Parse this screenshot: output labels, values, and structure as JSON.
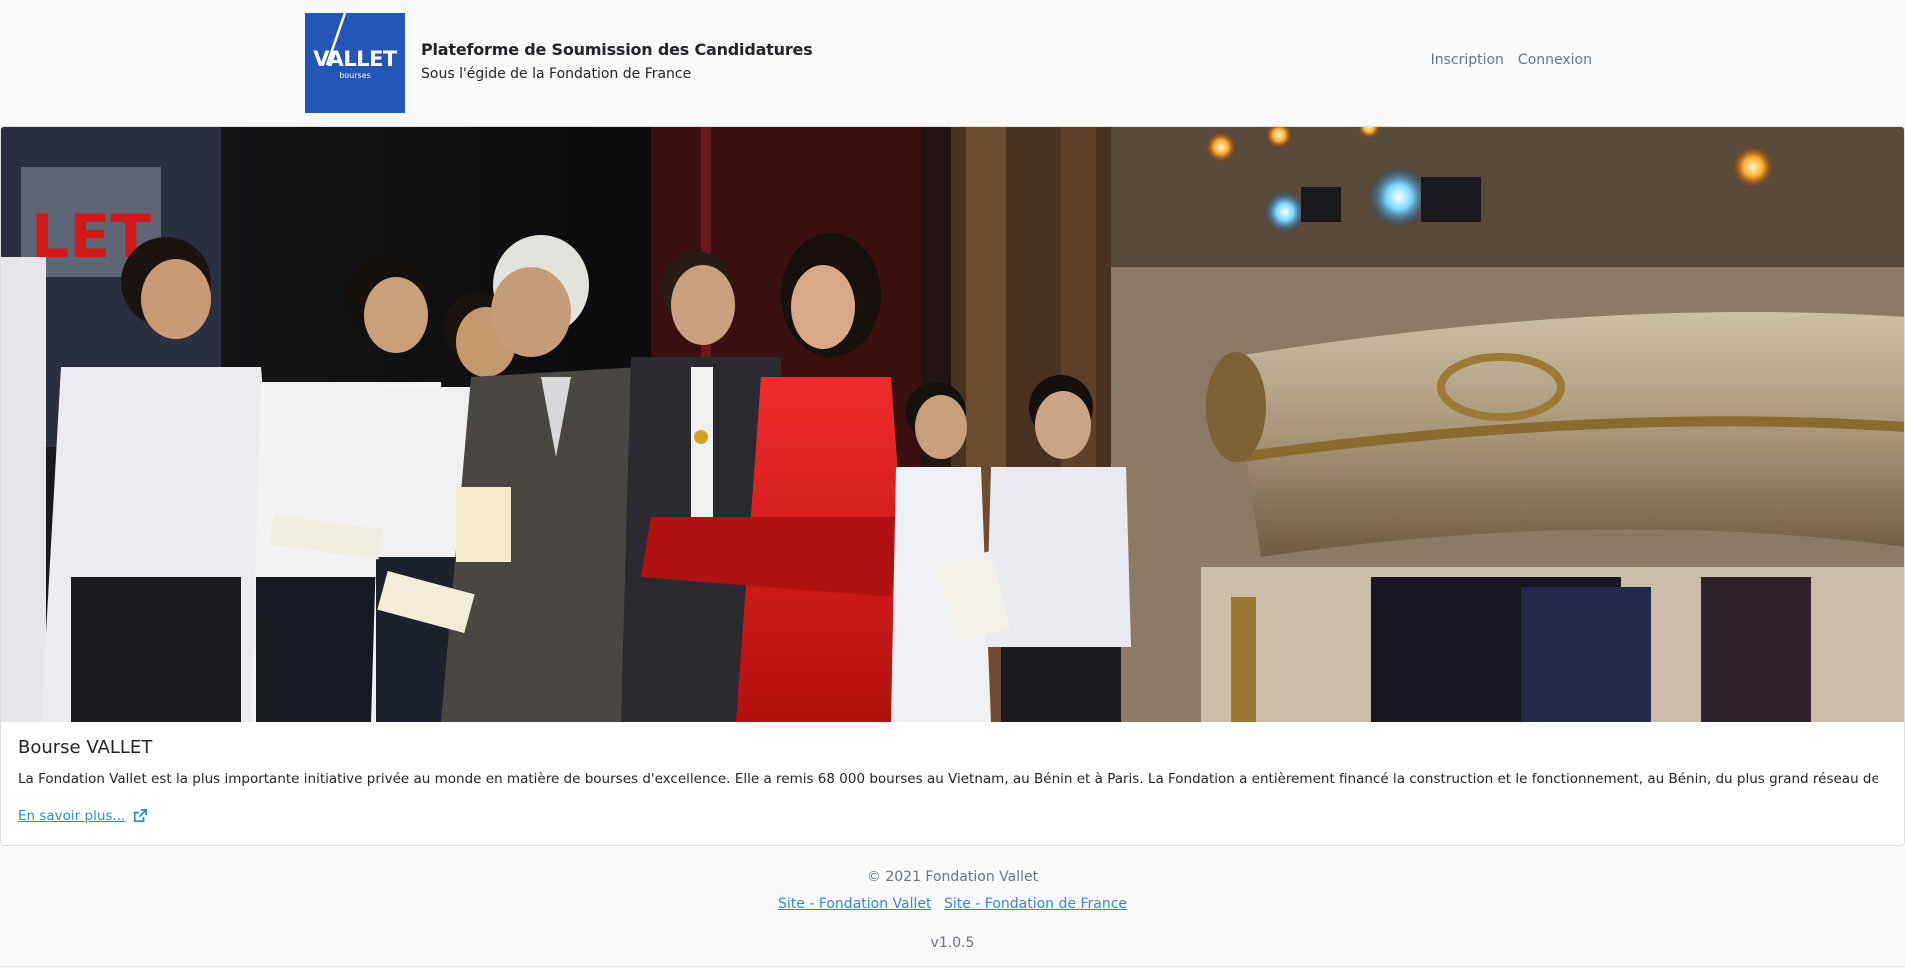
{
  "header": {
    "logo_word": "VALLET",
    "logo_sub": "bourses",
    "title": "Plateforme de Soumission des Candidatures",
    "subtitle": "Sous l'égide de la Fondation de France",
    "nav": [
      {
        "label": "Inscription"
      },
      {
        "label": "Connexion"
      }
    ]
  },
  "card": {
    "title": "Bourse VALLET",
    "text": "La Fondation Vallet est la plus importante initiative privée au monde en matière de bourses d'excellence. Elle a remis 68 000 bourses au Vietnam, au Bénin et à Paris. La Fondation a entièrement financé la construction et le fonctionnement, au Bénin, du plus grand réseau de bibliothèques ...",
    "more_label": "En savoir plus...",
    "more_icon": "external-link-icon"
  },
  "footer": {
    "copyright": "© 2021 Fondation Vallet",
    "links": [
      {
        "label": "Site - Fondation Vallet"
      },
      {
        "label": "Site - Fondation de France"
      }
    ],
    "version": "v1.0.5"
  },
  "colors": {
    "logo_bg": "#2456b8",
    "link": "#3b86d1",
    "muted": "#6c757d",
    "page_bg": "#f8f9fa"
  }
}
